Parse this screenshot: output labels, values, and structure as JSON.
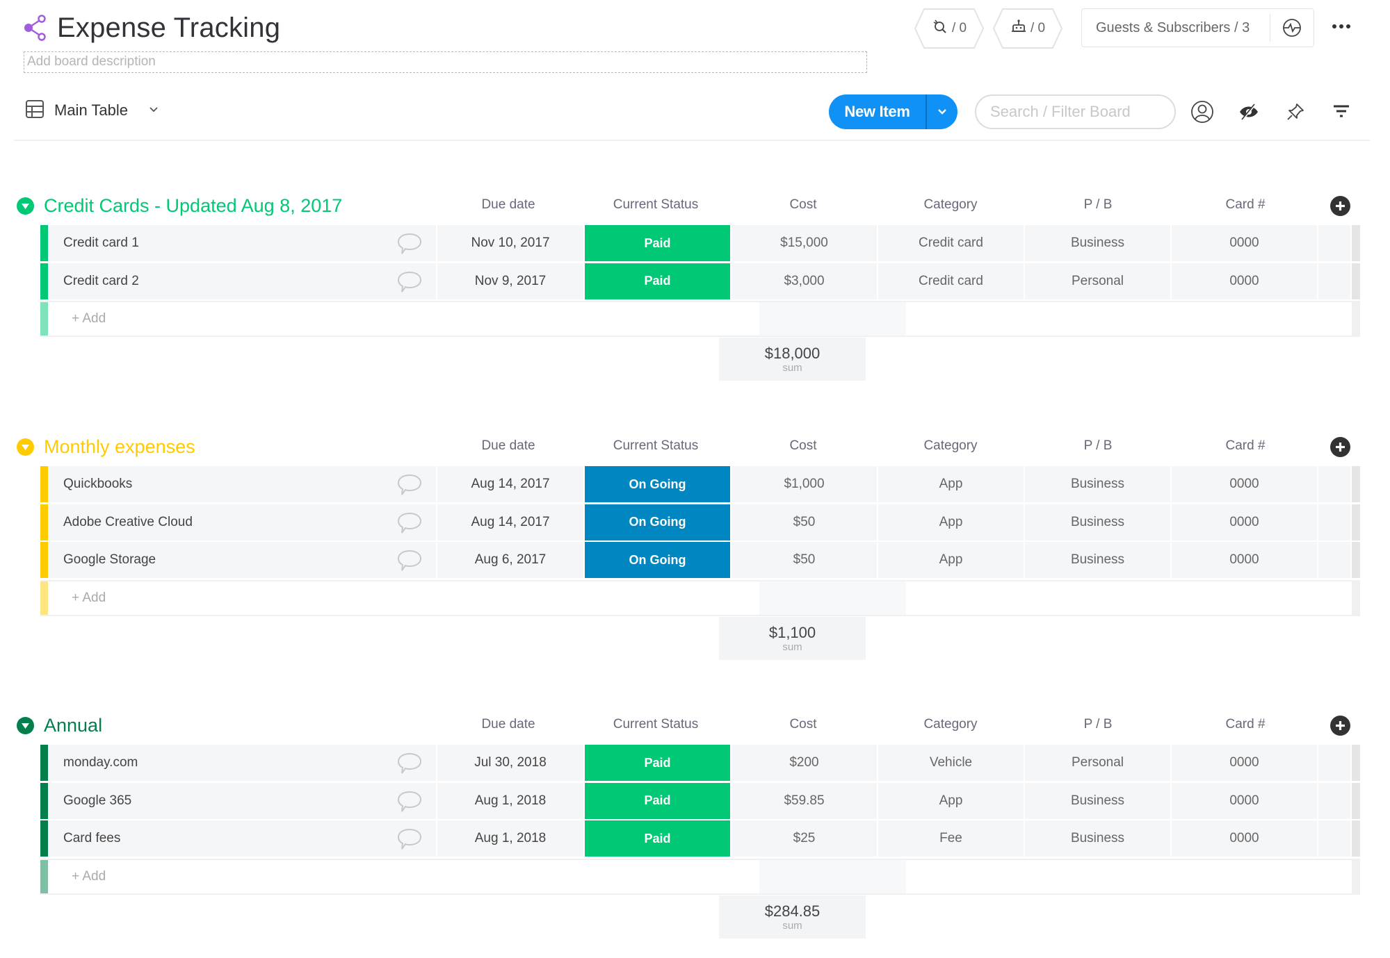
{
  "board": {
    "title": "Expense Tracking",
    "description_placeholder": "Add board description",
    "integrations_count": "/ 0",
    "automations_count": "/ 0",
    "guests_label": "Guests & Subscribers / 3"
  },
  "toolbar": {
    "view_name": "Main Table",
    "new_item_label": "New Item",
    "search_placeholder": "Search / Filter Board"
  },
  "columns": [
    "Due date",
    "Current Status",
    "Cost",
    "Category",
    "P / B",
    "Card #"
  ],
  "add_row_label": "+ Add",
  "sum_label": "sum",
  "status_colors": {
    "Paid": "#00c875",
    "On Going": "#0086c0"
  },
  "groups": [
    {
      "title": "Credit Cards - Updated Aug 8, 2017",
      "color": "#00c875",
      "add_stripe_color": "#7fe3ba",
      "sum": "$18,000",
      "rows": [
        {
          "name": "Credit card 1",
          "due": "Nov 10, 2017",
          "status": "Paid",
          "cost": "$15,000",
          "category": "Credit card",
          "pb": "Business",
          "card": "0000"
        },
        {
          "name": "Credit card 2",
          "due": "Nov 9, 2017",
          "status": "Paid",
          "cost": "$3,000",
          "category": "Credit card",
          "pb": "Personal",
          "card": "0000"
        }
      ]
    },
    {
      "title": "Monthly expenses",
      "color": "#ffcb00",
      "add_stripe_color": "#ffe580",
      "sum": "$1,100",
      "rows": [
        {
          "name": "Quickbooks",
          "due": "Aug 14, 2017",
          "status": "On Going",
          "cost": "$1,000",
          "category": "App",
          "pb": "Business",
          "card": "0000"
        },
        {
          "name": "Adobe Creative Cloud",
          "due": "Aug 14, 2017",
          "status": "On Going",
          "cost": "$50",
          "category": "App",
          "pb": "Business",
          "card": "0000"
        },
        {
          "name": "Google Storage",
          "due": "Aug 6, 2017",
          "status": "On Going",
          "cost": "$50",
          "category": "App",
          "pb": "Business",
          "card": "0000"
        }
      ]
    },
    {
      "title": "Annual",
      "color": "#037f4c",
      "add_stripe_color": "#81bfa5",
      "sum": "$284.85",
      "rows": [
        {
          "name": "monday.com",
          "due": "Jul 30, 2018",
          "status": "Paid",
          "cost": "$200",
          "category": "Vehicle",
          "pb": "Personal",
          "card": "0000"
        },
        {
          "name": "Google 365",
          "due": "Aug 1, 2018",
          "status": "Paid",
          "cost": "$59.85",
          "category": "App",
          "pb": "Business",
          "card": "0000"
        },
        {
          "name": "Card fees",
          "due": "Aug 1, 2018",
          "status": "Paid",
          "cost": "$25",
          "category": "Fee",
          "pb": "Business",
          "card": "0000"
        }
      ]
    }
  ]
}
